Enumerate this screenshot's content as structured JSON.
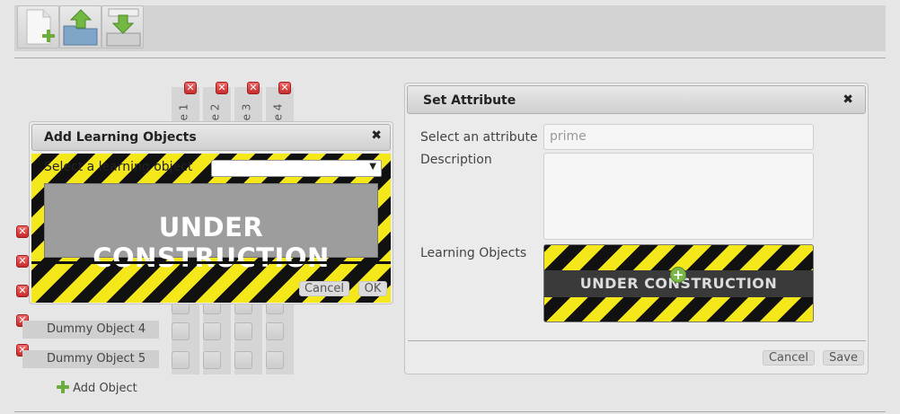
{
  "toolbar": {
    "buttons": [
      {
        "name": "new-file-button",
        "icon": "new-file-icon"
      },
      {
        "name": "open-folder-button",
        "icon": "upload-folder-icon"
      },
      {
        "name": "save-disk-button",
        "icon": "download-disk-icon"
      }
    ]
  },
  "matrix": {
    "columns": [
      "e 1",
      "e 2",
      "e 3",
      "e 4"
    ],
    "rows": [
      "Dummy Object 4",
      "Dummy Object 5"
    ],
    "add_object_label": "Add Object"
  },
  "add_dialog": {
    "title": "Add Learning Objects",
    "close_glyph": "✖",
    "select_label": "Select a learning object",
    "select_value": "",
    "banner_text": "UNDER CONSTRUCTION",
    "cancel_label": "Cancel",
    "ok_label": "OK"
  },
  "attr_dialog": {
    "title": "Set Attribute",
    "close_glyph": "✖",
    "attribute_label": "Select an attribute",
    "attribute_value": "prime",
    "description_label": "Description",
    "description_value": "",
    "learning_objects_label": "Learning Objects",
    "banner_text": "UNDER CONSTRUCTION",
    "cancel_label": "Cancel",
    "save_label": "Save"
  },
  "colors": {
    "hazard_yellow": "#f5e81a",
    "hazard_black": "#111111",
    "remove_red": "#d83a3a",
    "add_green": "#6aad3a"
  }
}
